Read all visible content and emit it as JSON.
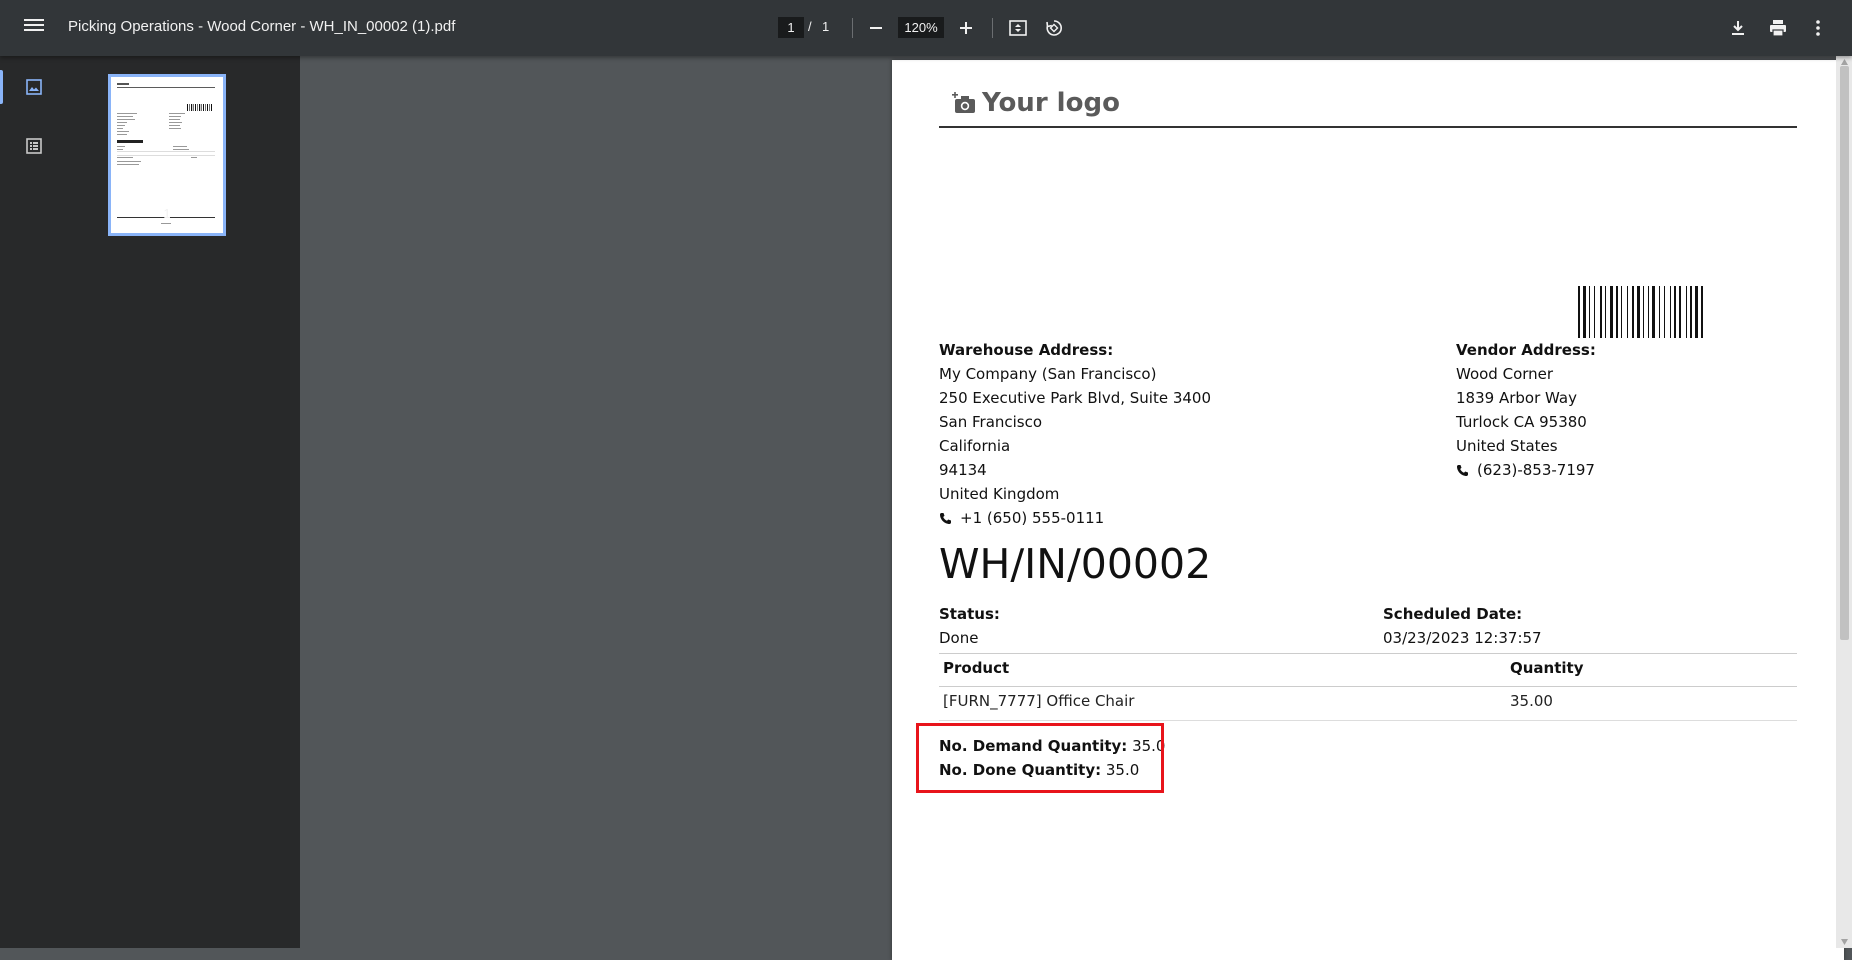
{
  "toolbar": {
    "title": "Picking Operations - Wood Corner - WH_IN_00002 (1).pdf",
    "current_page": "1",
    "page_separator": "/",
    "total_pages": "1",
    "zoom": "120%"
  },
  "sidebar": {
    "thumbnail_page_number": "1"
  },
  "document": {
    "logo_text": "Your logo",
    "warehouse": {
      "label": "Warehouse Address:",
      "lines": [
        "My Company (San Francisco)",
        "250 Executive Park Blvd, Suite 3400",
        "San Francisco",
        "California",
        "94134",
        "United Kingdom"
      ],
      "phone": "+1 (650) 555-0111"
    },
    "vendor": {
      "label": "Vendor Address:",
      "lines": [
        "Wood Corner",
        "1839 Arbor Way",
        "Turlock CA 95380",
        "United States"
      ],
      "phone": "(623)-853-7197"
    },
    "reference": "WH/IN/00002",
    "status_label": "Status:",
    "status_value": "Done",
    "scheduled_label": "Scheduled Date:",
    "scheduled_value": "03/23/2023 12:37:57",
    "table": {
      "headers": [
        "Product",
        "Quantity"
      ],
      "rows": [
        {
          "product": "[FURN_7777] Office Chair",
          "quantity": "35.00"
        }
      ]
    },
    "demand_label": "No. Demand Quantity:",
    "demand_value": "35.0",
    "done_label": "No. Done Quantity:",
    "done_value": "35.0"
  },
  "colors": {
    "toolbar_bg": "#323639",
    "sidebar_bg": "#28292a",
    "viewer_bg": "#525659",
    "accent": "#8ab4f8",
    "highlight": "#e8141b"
  }
}
